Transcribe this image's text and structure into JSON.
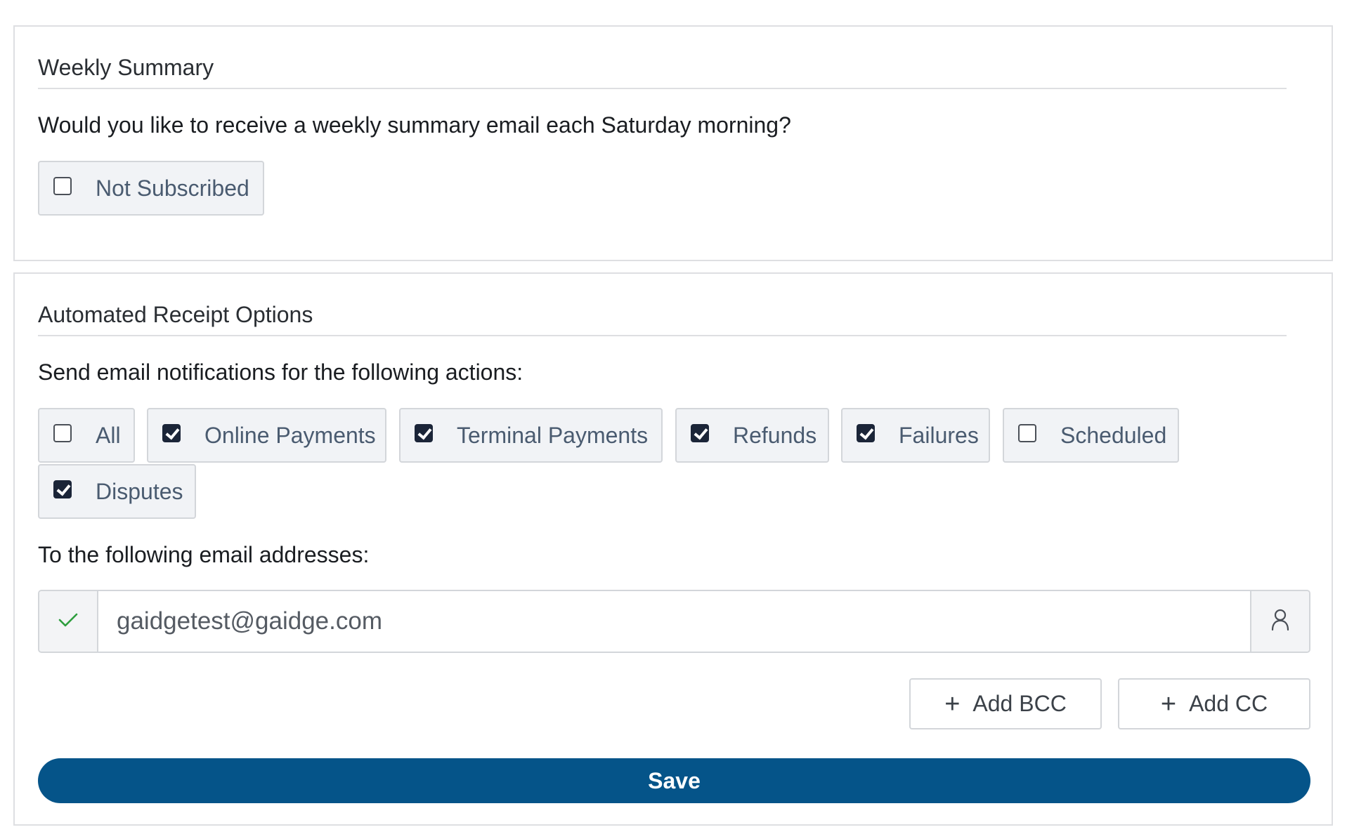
{
  "weekly": {
    "title": "Weekly Summary",
    "prompt": "Would you like to receive a weekly summary email each Saturday morning?",
    "subscription": {
      "label": "Not Subscribed",
      "checked": false
    }
  },
  "receipt": {
    "title": "Automated Receipt Options",
    "prompt": "Send email notifications for the following actions:",
    "options": [
      {
        "label": "All",
        "checked": false
      },
      {
        "label": "Online Payments",
        "checked": true
      },
      {
        "label": "Terminal Payments",
        "checked": true
      },
      {
        "label": "Refunds",
        "checked": true
      },
      {
        "label": "Failures",
        "checked": true
      },
      {
        "label": "Scheduled",
        "checked": false
      },
      {
        "label": "Disputes",
        "checked": true
      }
    ],
    "email_prompt": "To the following email addresses:",
    "email_value": "gaidgetest@gaidge.com",
    "email_valid_icon": "check-icon",
    "contact_icon": "user-icon",
    "add_bcc_label": "Add BCC",
    "add_cc_label": "Add CC",
    "save_label": "Save"
  },
  "colors": {
    "primary": "#055489",
    "checkbox_checked": "#1b2538",
    "valid": "#2e9e3e"
  }
}
